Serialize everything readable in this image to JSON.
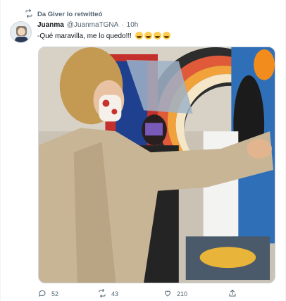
{
  "retweet": {
    "icon": "retweet-icon",
    "text": "Da Giver lo retwitteó"
  },
  "tweet": {
    "author_name": "Juanma",
    "author_handle": "@JuanmaTGNA",
    "separator": "·",
    "time": "10h",
    "text": "-Qué maravilla, me lo quedo!!!",
    "emoji_count": 4,
    "emoji": "face-with-tears-of-joy"
  },
  "actions": {
    "reply_count": "52",
    "retweet_count": "43",
    "like_count": "210"
  },
  "colors": {
    "secondary_text": "#536471",
    "border": "#cfd9de"
  }
}
